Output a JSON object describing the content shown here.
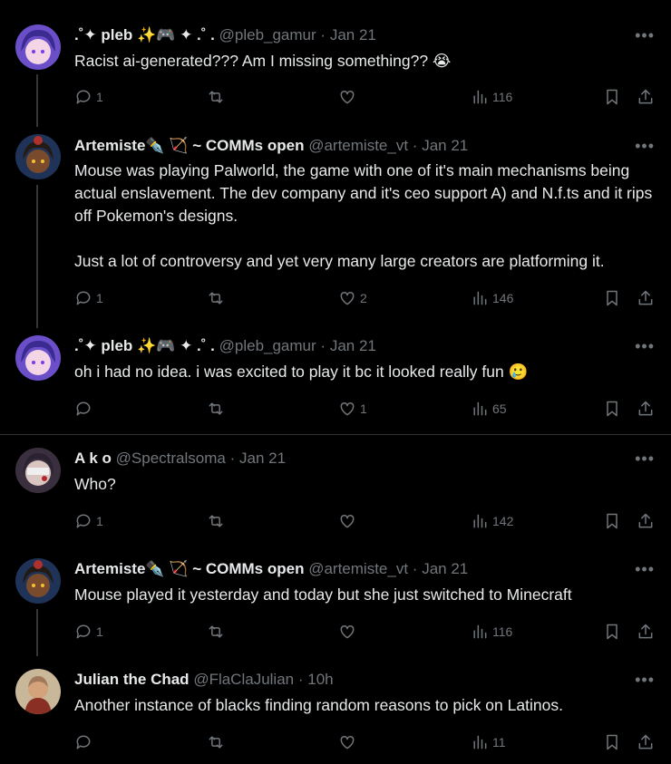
{
  "tweets": [
    {
      "name": ".˚✦ pleb ✨🎮 ✦ .˚ .",
      "handle": "@pleb_gamur",
      "date": "Jan 21",
      "text": "Racist ai-generated??? Am I missing something?? 😭",
      "replies": "1",
      "likes": "",
      "views": "116"
    },
    {
      "name": "Artemiste✒️ 🏹 ~ COMMs open",
      "handle": "@artemiste_vt",
      "date": "Jan 21",
      "text": "Mouse was playing Palworld, the game with one of it's main mechanisms being actual enslavement. The dev company and it's ceo support A) and N.f.ts and it rips off Pokemon's designs.\n\nJust a lot of controversy and yet very many large creators are platforming it.",
      "replies": "1",
      "likes": "2",
      "views": "146"
    },
    {
      "name": ".˚✦ pleb ✨🎮 ✦ .˚ .",
      "handle": "@pleb_gamur",
      "date": "Jan 21",
      "text": "oh i had no idea. i was excited to play it bc it looked really fun 🥲",
      "replies": "",
      "likes": "1",
      "views": "65"
    },
    {
      "name": "A k o",
      "handle": "@Spectralsoma",
      "date": "Jan 21",
      "text": "Who?",
      "replies": "1",
      "likes": "",
      "views": "142"
    },
    {
      "name": "Artemiste✒️ 🏹 ~ COMMs open",
      "handle": "@artemiste_vt",
      "date": "Jan 21",
      "text": "Mouse played it yesterday and today but she just switched to Minecraft",
      "replies": "1",
      "likes": "",
      "views": "116"
    },
    {
      "name": "Julian the Chad",
      "handle": "@FlaClaJulian",
      "date": "10h",
      "text": "Another instance of blacks finding random reasons to pick on Latinos.",
      "replies": "",
      "likes": "",
      "views": "11"
    }
  ],
  "icons": {
    "reply": "reply-icon",
    "repost": "repost-icon",
    "like": "heart-icon",
    "views": "views-icon",
    "bookmark": "bookmark-icon",
    "share": "share-icon",
    "more": "more-icon"
  },
  "colors": {
    "background": "#000000",
    "text": "#e7e9ea",
    "muted": "#71767b",
    "divider": "#2f3336"
  }
}
